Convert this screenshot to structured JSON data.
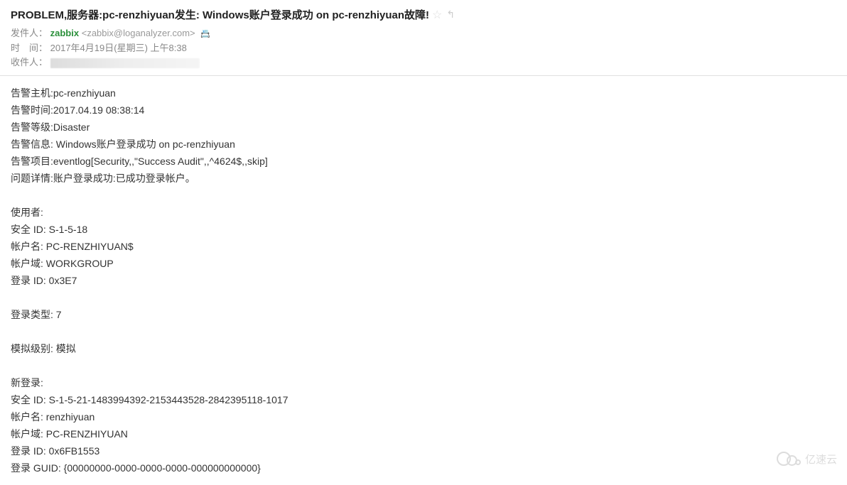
{
  "subject": "PROBLEM,服务器:pc-renzhiyuan发生: Windows账户登录成功 on pc-renzhiyuan故障!",
  "labels": {
    "sender": "发件人：",
    "time": "时　间：",
    "recipient": "收件人："
  },
  "sender": {
    "name": "zabbix",
    "email": "<zabbix@loganalyzer.com>"
  },
  "timestamp": "2017年4月19日(星期三) 上午8:38",
  "body_lines": [
    "告警主机:pc-renzhiyuan",
    "告警时间:2017.04.19 08:38:14",
    "告警等级:Disaster",
    "告警信息: Windows账户登录成功 on pc-renzhiyuan",
    "告警项目:eventlog[Security,,\"Success Audit\",,^4624$,,skip]",
    "问题详情:账户登录成功:已成功登录帐户。",
    "",
    "使用者:",
    "安全 ID: S-1-5-18",
    "帐户名: PC-RENZHIYUAN$",
    "帐户域: WORKGROUP",
    "登录 ID: 0x3E7",
    "",
    "登录类型: 7",
    "",
    "模拟级别: 模拟",
    "",
    "新登录:",
    "安全 ID: S-1-5-21-1483994392-2153443528-2842395118-1017",
    "帐户名: renzhiyuan",
    "帐户域: PC-RENZHIYUAN",
    "登录 ID: 0x6FB1553",
    "登录 GUID: {00000000-0000-0000-0000-000000000000}"
  ],
  "watermark": "亿速云"
}
